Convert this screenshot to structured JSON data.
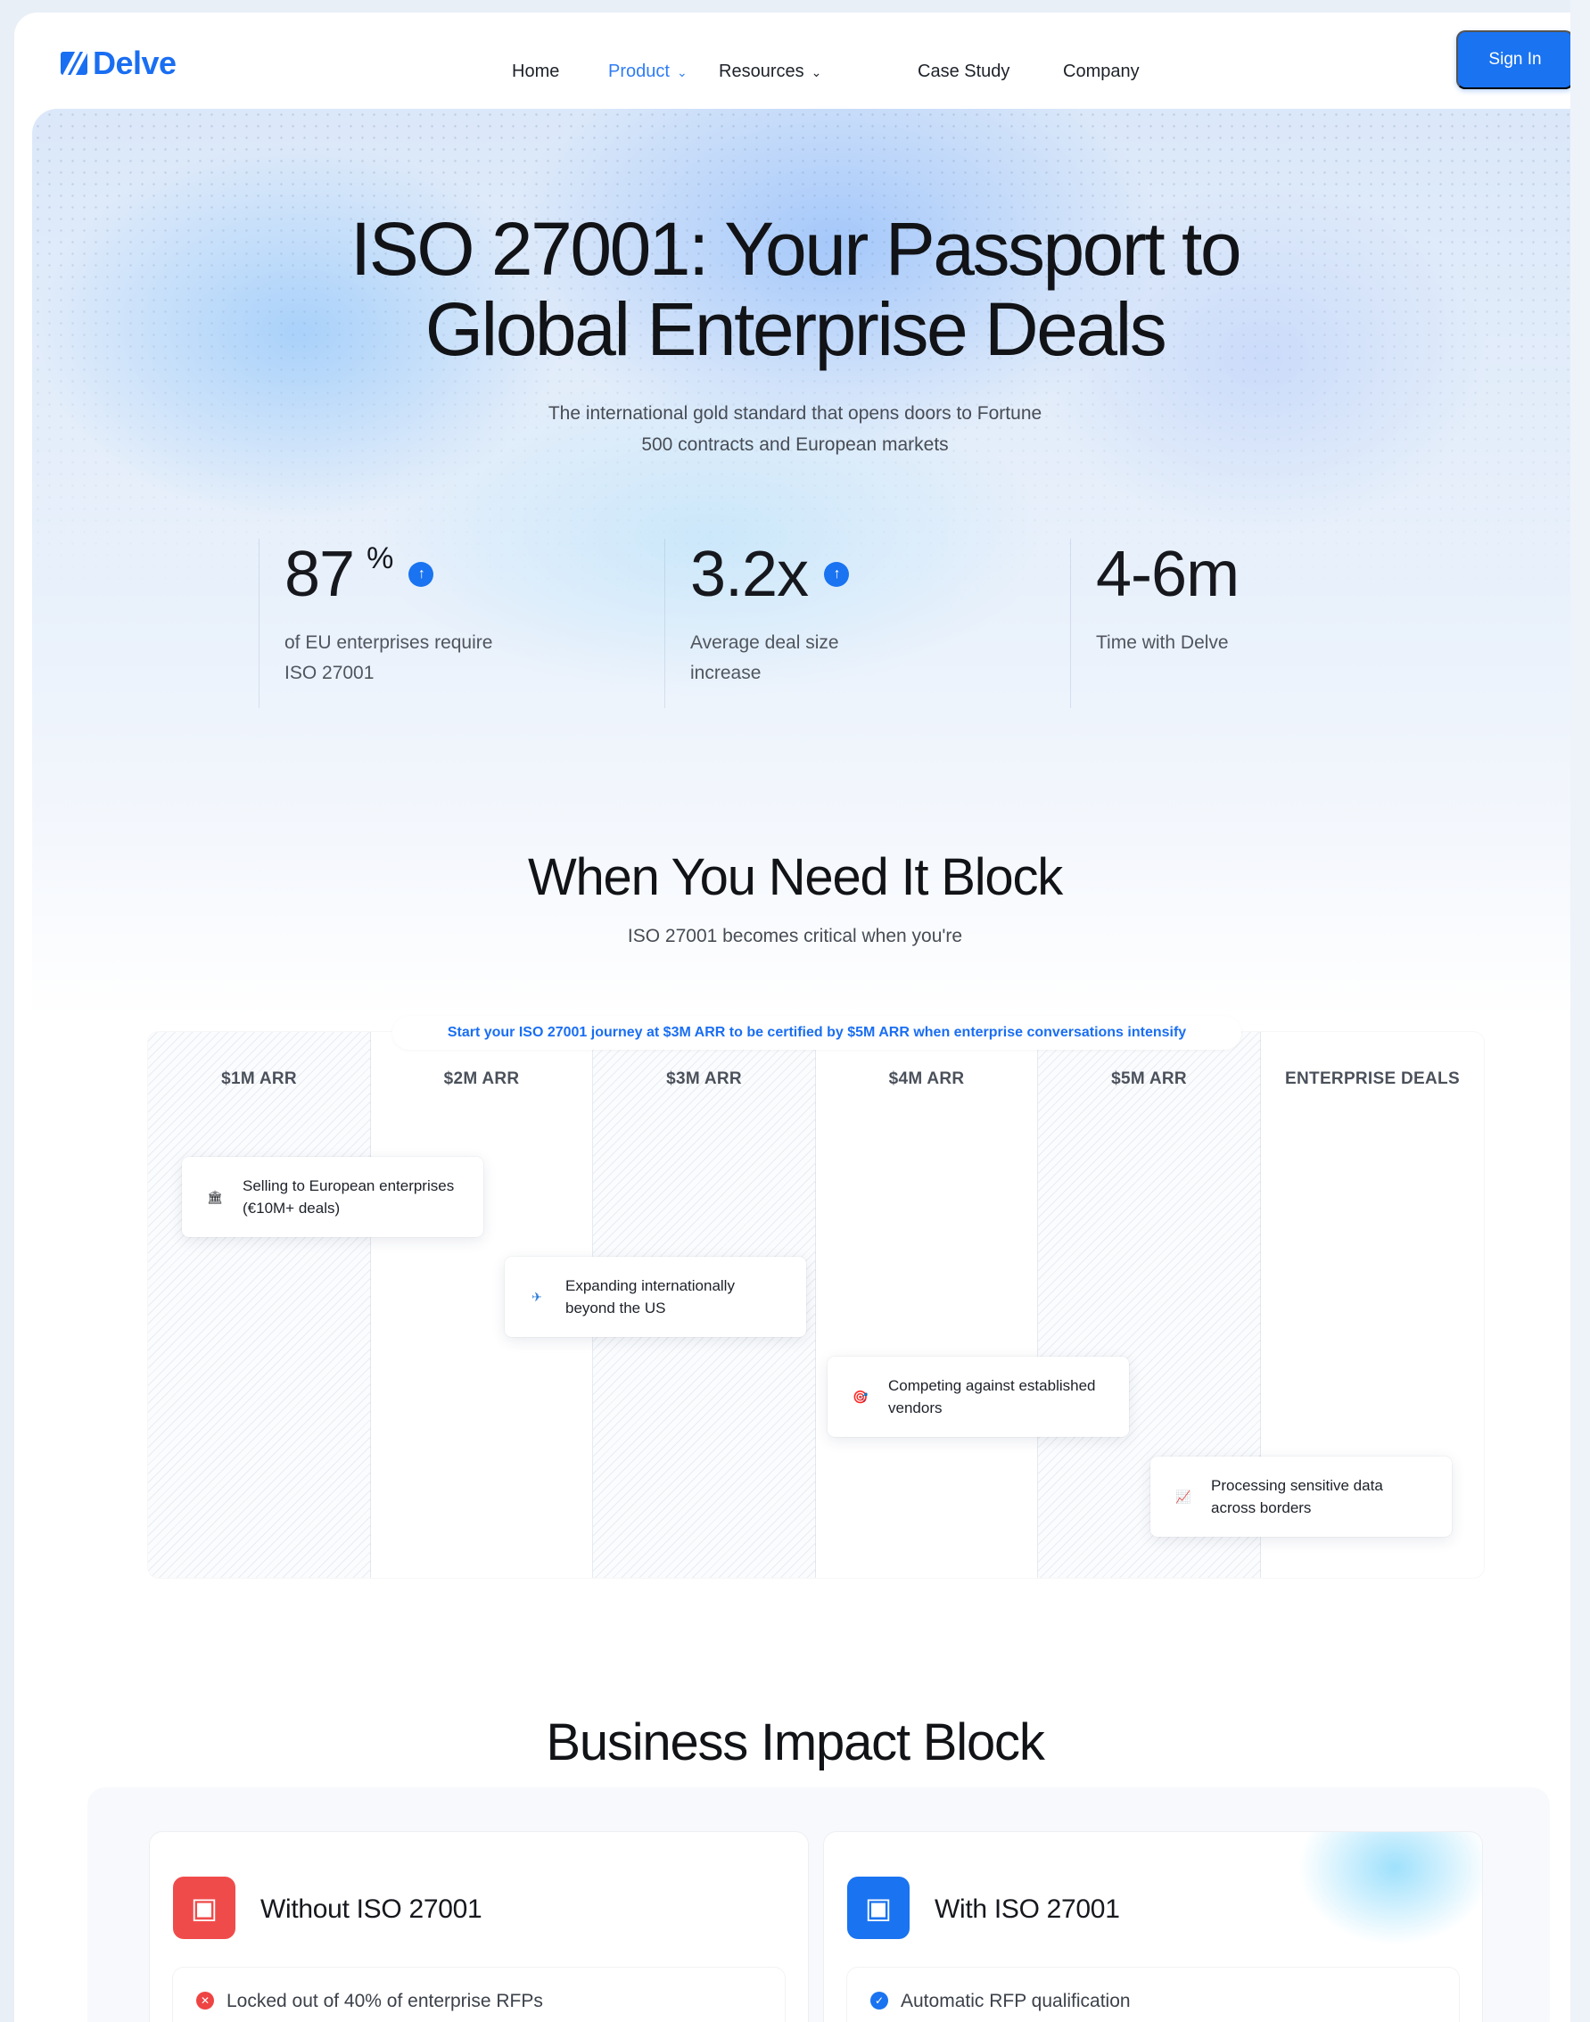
{
  "nav": {
    "brand": "Delve",
    "links": [
      {
        "label": "Home",
        "active": false,
        "dropdown": false
      },
      {
        "label": "Product",
        "active": true,
        "dropdown": true
      },
      {
        "label": "Resources",
        "active": false,
        "dropdown": true
      },
      {
        "label": "Case Study",
        "active": false,
        "dropdown": false
      },
      {
        "label": "Company",
        "active": false,
        "dropdown": false
      }
    ],
    "sign_in": "Sign In",
    "chevron": "⌄"
  },
  "hero": {
    "title_line1": "ISO 27001: Your Passport to",
    "title_line2": "Global Enterprise Deals",
    "subtitle_line1": "The international gold standard that opens doors to Fortune",
    "subtitle_line2": "500 contracts and European markets",
    "stats": [
      {
        "value": "87",
        "unit": "%",
        "icon": "↑",
        "label_line1": "of EU enterprises require",
        "label_line2": "ISO 27001"
      },
      {
        "value": "3.2x",
        "unit": "",
        "icon": "↑",
        "label_line1": "Average deal size",
        "label_line2": "increase"
      },
      {
        "value": "4-6m",
        "unit": "",
        "icon": "",
        "label_line1": "Time with Delve",
        "label_line2": ""
      }
    ]
  },
  "when_block": {
    "title": "When You Need It Block",
    "subtitle": "ISO 27001 becomes critical when you're",
    "banner": "Start your ISO 27001 journey at $3M ARR to be certified by $5M ARR when enterprise conversations intensify",
    "columns": [
      "$1M ARR",
      "$2M ARR",
      "$3M ARR",
      "$4M ARR",
      "$5M ARR",
      "ENTERPRISE DEALS"
    ],
    "events": [
      {
        "icon": "🏛",
        "line1": "Selling to European enterprises",
        "line2": "(€10M+ deals)"
      },
      {
        "icon": "✈",
        "line1": "Expanding internationally",
        "line2": "beyond the US"
      },
      {
        "icon": "🎯",
        "line1": "Competing against established",
        "line2": "vendors"
      },
      {
        "icon": "📈",
        "line1": "Processing sensitive data",
        "line2": "across borders"
      }
    ]
  },
  "impact_block": {
    "title": "Business Impact Block",
    "without": {
      "title": "Without ISO 27001",
      "icon": "▣",
      "item": "Locked out of 40% of enterprise RFPs",
      "bullet": "✕"
    },
    "with": {
      "title": "With ISO 27001",
      "icon": "▣",
      "item": "Automatic RFP qualification",
      "bullet": "✓"
    }
  },
  "colors": {
    "accent": "#1a73f0",
    "danger": "#f04b4b",
    "text": "#16181d"
  }
}
